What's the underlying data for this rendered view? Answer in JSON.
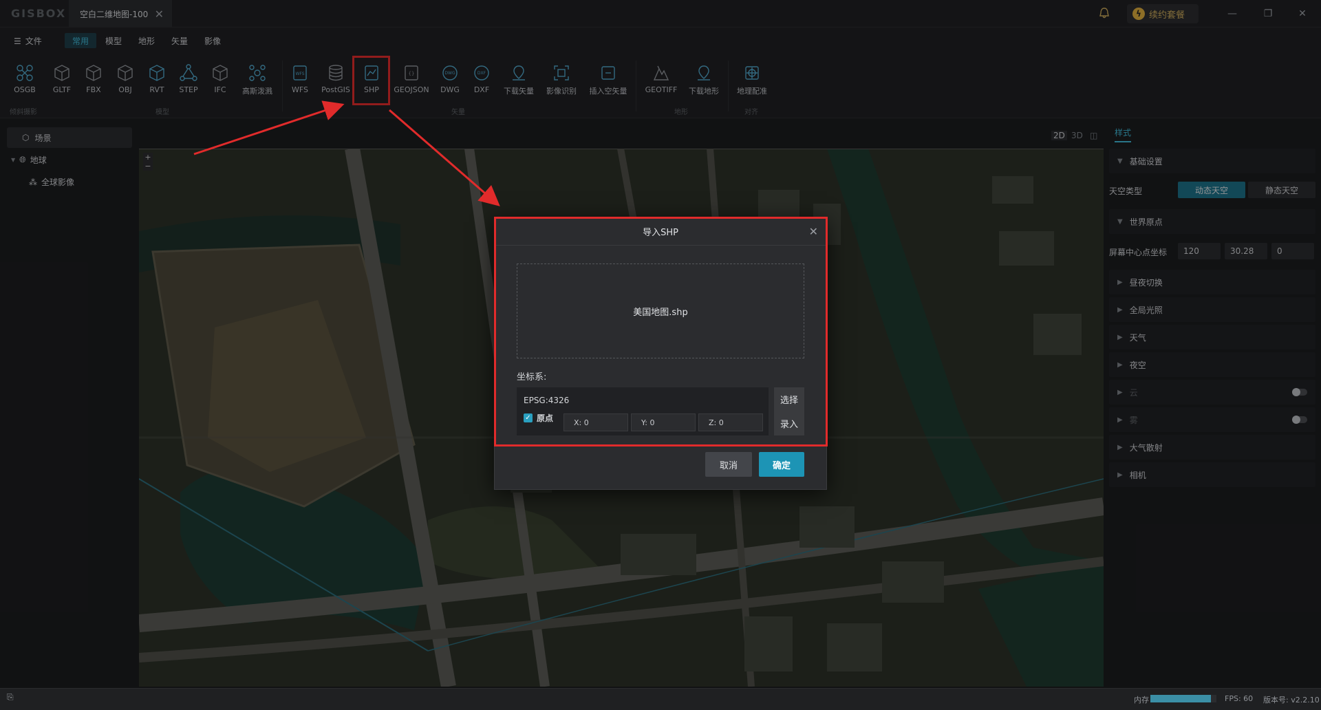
{
  "app": {
    "logo": "GISBOX",
    "doc_tab": "空白二维地图-100",
    "renew": "续约套餐"
  },
  "menu": {
    "file": "文件",
    "tabs": [
      "常用",
      "模型",
      "地形",
      "矢量",
      "影像"
    ],
    "active_tab": "常用"
  },
  "ribbon": {
    "tools": [
      "OSGB",
      "GLTF",
      "FBX",
      "OBJ",
      "RVT",
      "STEP",
      "IFC",
      "高斯泼溅",
      "WFS",
      "PostGIS",
      "SHP",
      "GEOJSON",
      "DWG",
      "DXF",
      "下载矢量",
      "影像识别",
      "插入空矢量",
      "GEOTIFF",
      "下载地形",
      "地理配准"
    ],
    "groups": [
      "倾斜摄影",
      "模型",
      "矢量",
      "地形",
      "对齐"
    ]
  },
  "left_panel": {
    "scene": "场景",
    "earth": "地球",
    "global_imagery": "全球影像"
  },
  "view_modes": [
    "2D",
    "3D",
    "◫"
  ],
  "right_panel": {
    "tab": "样式",
    "basic": "基础设置",
    "sky_type_label": "天空类型",
    "sky_dynamic": "动态天空",
    "sky_static": "静态天空",
    "world_origin": "世界原点",
    "screen_center_label": "屏幕中心点坐标",
    "screen_center": [
      "120",
      "30.28",
      "0"
    ],
    "sections": [
      "昼夜切换",
      "全局光照",
      "天气",
      "夜空",
      "云",
      "雾",
      "大气散射",
      "相机"
    ]
  },
  "dialog": {
    "title": "导入SHP",
    "file": "美国地图.shp",
    "crs_label": "坐标系:",
    "crs_value": "EPSG:4326",
    "origin_label": "原点",
    "x": "X: 0",
    "y": "Y: 0",
    "z": "Z: 0",
    "select": "选择",
    "enter": "录入",
    "cancel": "取消",
    "ok": "确定"
  },
  "status": {
    "memory_label": "内存",
    "memory_fraction": 0.92,
    "fps": "FPS: 60",
    "version": "版本号: v2.2.10"
  },
  "colors": {
    "accent": "#1d94b5",
    "highlight": "#e12b2b"
  }
}
